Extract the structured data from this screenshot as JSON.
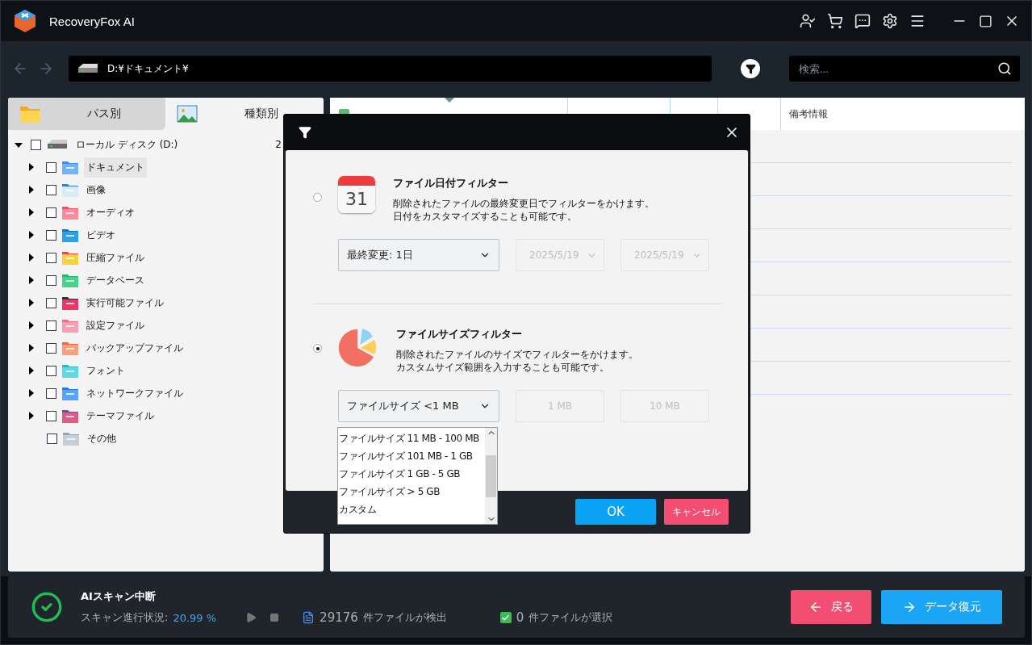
{
  "app": {
    "title": "RecoveryFox AI"
  },
  "path": "D:¥ドキュメント¥",
  "search": {
    "placeholder": "検索..."
  },
  "left_tabs": [
    {
      "label": "パス別",
      "kind": "path",
      "selected": false
    },
    {
      "label": "種類別",
      "kind": "type",
      "selected": true
    }
  ],
  "tree": {
    "label": "ローカル ディスク (D:)",
    "count": "2",
    "checked": false,
    "expanded": true,
    "children": [
      {
        "label": "ドキュメント",
        "kind": "document",
        "checked": false,
        "selected": true,
        "expandable": true
      },
      {
        "label": "画像",
        "kind": "image",
        "checked": false,
        "selected": false,
        "expandable": true
      },
      {
        "label": "オーディオ",
        "kind": "audio",
        "checked": false,
        "selected": false,
        "expandable": true
      },
      {
        "label": "ビデオ",
        "kind": "video",
        "checked": false,
        "selected": false,
        "expandable": true
      },
      {
        "label": "圧縮ファイル",
        "kind": "archive",
        "checked": false,
        "selected": false,
        "expandable": true
      },
      {
        "label": "データベース",
        "kind": "database",
        "checked": false,
        "selected": false,
        "expandable": true
      },
      {
        "label": "実行可能ファイル",
        "kind": "executable",
        "checked": false,
        "selected": false,
        "expandable": true
      },
      {
        "label": "設定ファイル",
        "kind": "config",
        "checked": false,
        "selected": false,
        "expandable": true
      },
      {
        "label": "バックアップファイル",
        "kind": "backup",
        "checked": false,
        "selected": false,
        "expandable": true
      },
      {
        "label": "フォント",
        "kind": "font",
        "checked": false,
        "selected": false,
        "expandable": true
      },
      {
        "label": "ネットワークファイル",
        "kind": "network",
        "checked": false,
        "selected": false,
        "expandable": true
      },
      {
        "label": "テーマファイル",
        "kind": "theme",
        "checked": false,
        "selected": false,
        "expandable": true
      },
      {
        "label": "その他",
        "kind": "other",
        "checked": false,
        "selected": false,
        "expandable": false
      }
    ]
  },
  "table": {
    "select_all_checked": true,
    "columns": [
      "備考情報"
    ]
  },
  "dialog": {
    "filters": [
      {
        "kind": "date",
        "title": "ファイル日付フィルター",
        "icon_text": "31",
        "description": [
          "削除されたファイルの最終変更日でフィルターをかけます。",
          "日付をカスタマイズすることも可能です。"
        ],
        "selected": false,
        "dropdown": "最終変更: 1日",
        "range": [
          "2025/5/19",
          "2025/5/19"
        ],
        "range_dropdowns": true
      },
      {
        "kind": "size",
        "title": "ファイルサイズフィルター",
        "description": [
          "削除されたファイルのサイズでフィルターをかけます。",
          "カスタムサイズ範囲を入力することも可能です。"
        ],
        "selected": true,
        "dropdown": "ファイルサイズ <1 MB",
        "range": [
          "1 MB",
          "10 MB"
        ],
        "range_dropdowns": false,
        "options": [
          "ファイルサイズ 11 MB - 100 MB",
          "ファイルサイズ 101 MB - 1 GB",
          "ファイルサイズ 1 GB - 5 GB",
          "ファイルサイズ > 5 GB",
          "カスタム"
        ]
      }
    ],
    "ok": "OK",
    "cancel": "キャンセル"
  },
  "status": {
    "title": "AIスキャン中断",
    "progress_label": "スキャン進行状況:",
    "progress_value": "20.99 %",
    "found_count": "29176",
    "found_label": "件ファイルが検出",
    "selected_count": "0",
    "selected_label": "件ファイルが選択",
    "selected_checked": true
  },
  "buttons": [
    {
      "kind": "back",
      "label": "戻る"
    },
    {
      "kind": "recover",
      "label": "データ復元"
    }
  ]
}
